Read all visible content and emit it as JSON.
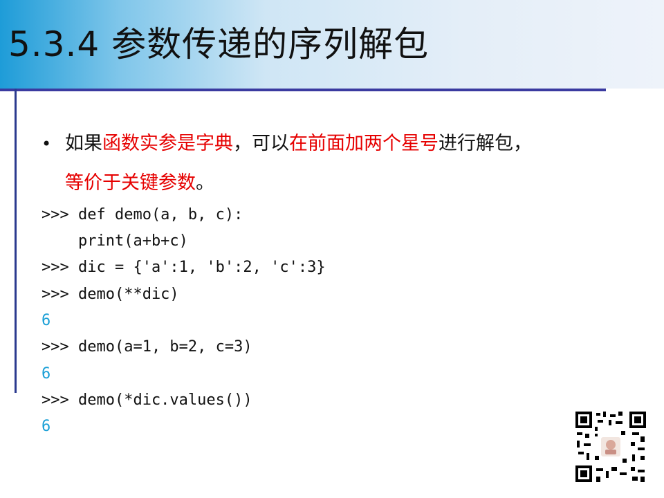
{
  "slide": {
    "title": "5.3.4 参数传递的序列解包",
    "bullet": {
      "dot": "•",
      "line1_parts": [
        {
          "text": "如果",
          "red": false
        },
        {
          "text": "函数实参是字典",
          "red": true
        },
        {
          "text": "，可以",
          "red": false
        },
        {
          "text": "在前面加两个星号",
          "red": true
        },
        {
          "text": "进行解包，",
          "red": false
        }
      ],
      "line2_parts": [
        {
          "text": "等价于关键参数",
          "red": true
        },
        {
          "text": "。",
          "red": false
        }
      ]
    },
    "code": [
      {
        "text": ">>> def demo(a, b, c):",
        "kind": "input"
      },
      {
        "text": "    print(a+b+c)",
        "kind": "input"
      },
      {
        "text": ">>> dic = {'a':1, 'b':2, 'c':3}",
        "kind": "input"
      },
      {
        "text": ">>> demo(**dic)",
        "kind": "input"
      },
      {
        "text": "6",
        "kind": "output"
      },
      {
        "text": ">>> demo(a=1, b=2, c=3)",
        "kind": "input"
      },
      {
        "text": "6",
        "kind": "output"
      },
      {
        "text": ">>> demo(*dic.values())",
        "kind": "input"
      },
      {
        "text": "6",
        "kind": "output"
      }
    ],
    "colors": {
      "highlight": "#e60000",
      "output": "#1a9fd6",
      "rule": "#3a3aa0"
    },
    "qr_icon": "qr-code-icon"
  }
}
